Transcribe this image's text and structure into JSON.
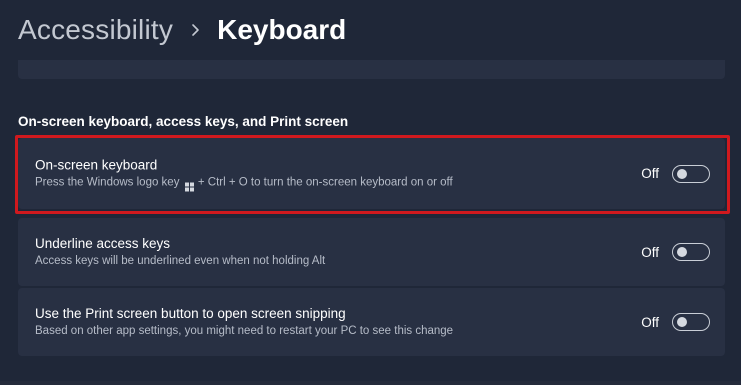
{
  "breadcrumb": {
    "parent": "Accessibility",
    "separator_icon": "chevron-right-icon",
    "current": "Keyboard"
  },
  "section": {
    "title": "On-screen keyboard, access keys, and Print screen"
  },
  "settings": [
    {
      "title": "On-screen keyboard",
      "desc_before_icon": "Press the Windows logo key",
      "desc_icon": "windows-logo-icon",
      "desc_after_icon": "+ Ctrl + O to turn the on-screen keyboard on or off",
      "state": "Off",
      "highlighted": true
    },
    {
      "title": "Underline access keys",
      "desc": "Access keys will be underlined even when not holding Alt",
      "state": "Off"
    },
    {
      "title": "Use the Print screen button to open screen snipping",
      "desc": "Based on other app settings, you might need to restart your PC to see this change",
      "state": "Off"
    }
  ],
  "colors": {
    "background": "#1f2738",
    "card": "#283043",
    "highlight": "#d0191e",
    "secondary_text": "#b6bcc8"
  }
}
